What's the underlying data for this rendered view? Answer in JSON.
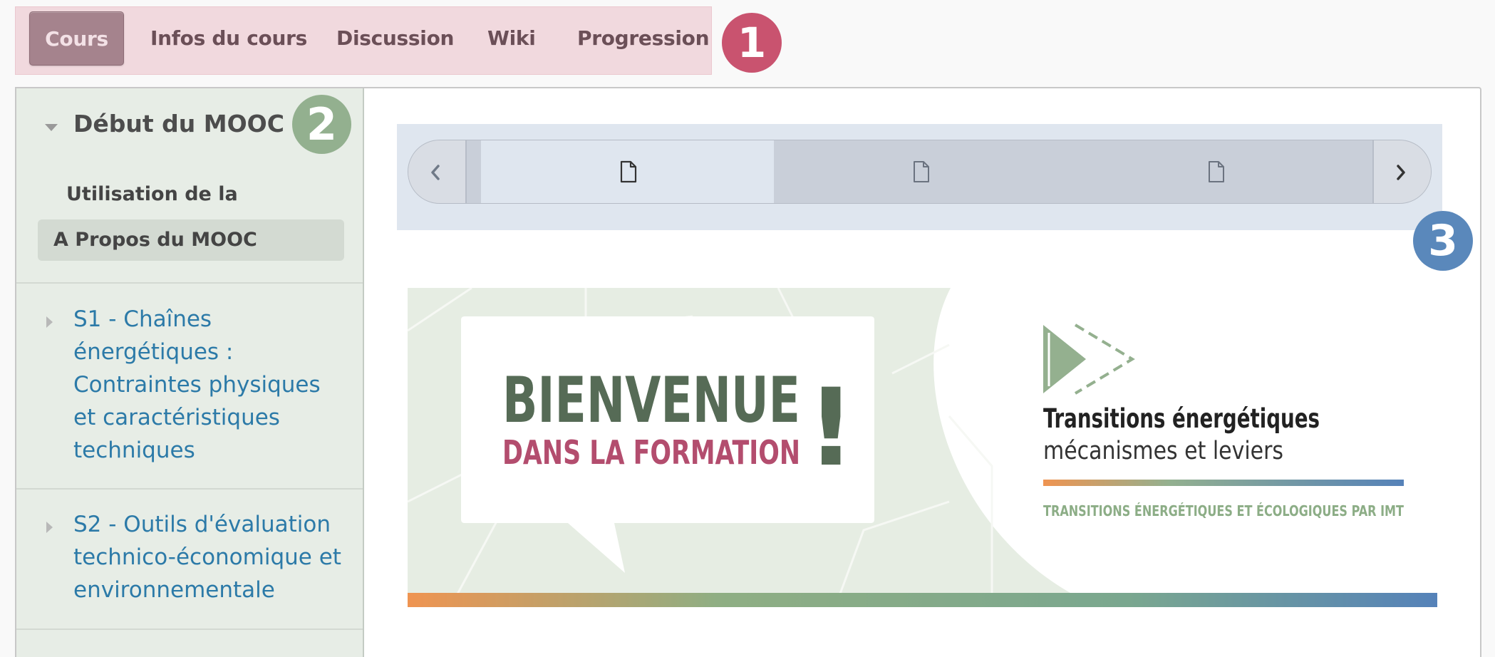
{
  "tabs": [
    {
      "label": "Cours",
      "active": true
    },
    {
      "label": "Infos du cours",
      "active": false
    },
    {
      "label": "Discussion",
      "active": false
    },
    {
      "label": "Wiki",
      "active": false
    },
    {
      "label": "Progression",
      "active": false
    }
  ],
  "badges": {
    "one": "1",
    "two": "2",
    "three": "3"
  },
  "colors": {
    "badge_one": "#c9536f",
    "badge_two": "#93b08f",
    "badge_three": "#5a88bb",
    "section_link": "#2c7aa8"
  },
  "sidebar": {
    "chapter_title": "Début du MOOC",
    "sequences": [
      {
        "label": "Utilisation de la plateforme",
        "active": false
      },
      {
        "label": "A Propos du MOOC",
        "active": true
      }
    ],
    "sections": [
      {
        "lines": [
          "S1 - Chaînes",
          "énergétiques :",
          "Contraintes physiques",
          "et caractéristiques",
          "techniques"
        ]
      },
      {
        "lines": [
          "S2 - Outils d'évaluation",
          "technico-économique et",
          "environnementale"
        ]
      }
    ]
  },
  "sequence_nav": {
    "prev_icon": "chevron-left-icon",
    "next_icon": "chevron-right-icon",
    "units": [
      {
        "icon": "document-icon",
        "active": true
      },
      {
        "icon": "document-icon",
        "active": false
      },
      {
        "icon": "document-icon",
        "active": false
      }
    ]
  },
  "banner": {
    "welcome_line1": "BIENVENUE",
    "welcome_line2": "DANS LA FORMATION",
    "exclamation": "!",
    "course_title": "Transitions énergétiques",
    "course_subtitle": "mécanismes et leviers",
    "tagline": "TRANSITIONS ÉNERGÉTIQUES ET ÉCOLOGIQUES PAR IMT",
    "logo_icon": "play-arrow-logo-icon"
  }
}
